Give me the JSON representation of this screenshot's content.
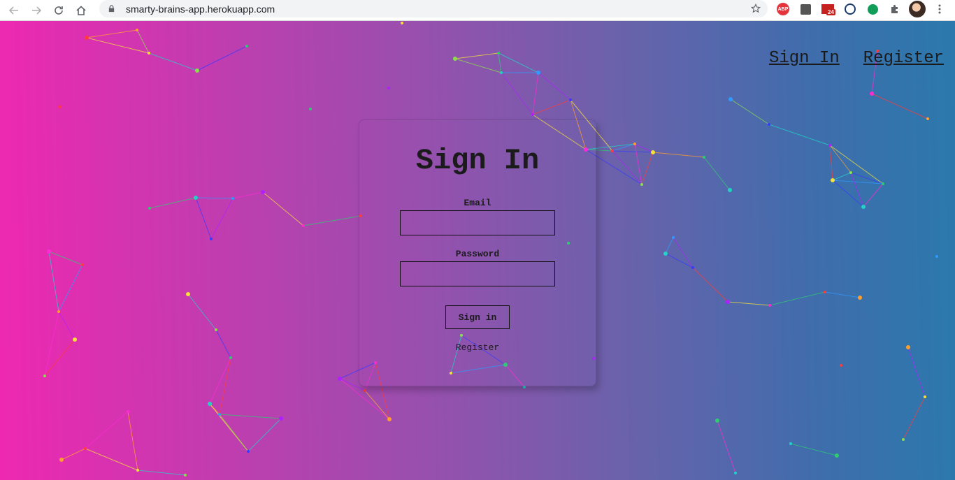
{
  "browser": {
    "url": "smarty-brains-app.herokuapp.com",
    "extensions": {
      "adblock_label": "ABP",
      "mail_badge": "24"
    }
  },
  "nav": {
    "sign_in_label": "Sign In",
    "register_label": "Register"
  },
  "form": {
    "title": "Sign In",
    "email_label": "Email",
    "email_value": "",
    "password_label": "Password",
    "password_value": "",
    "submit_label": "Sign in",
    "register_link": "Register"
  },
  "colors": {
    "gradient_left": "#ee28b1",
    "gradient_right": "#2b79ad",
    "text": "#1b1b1b"
  }
}
